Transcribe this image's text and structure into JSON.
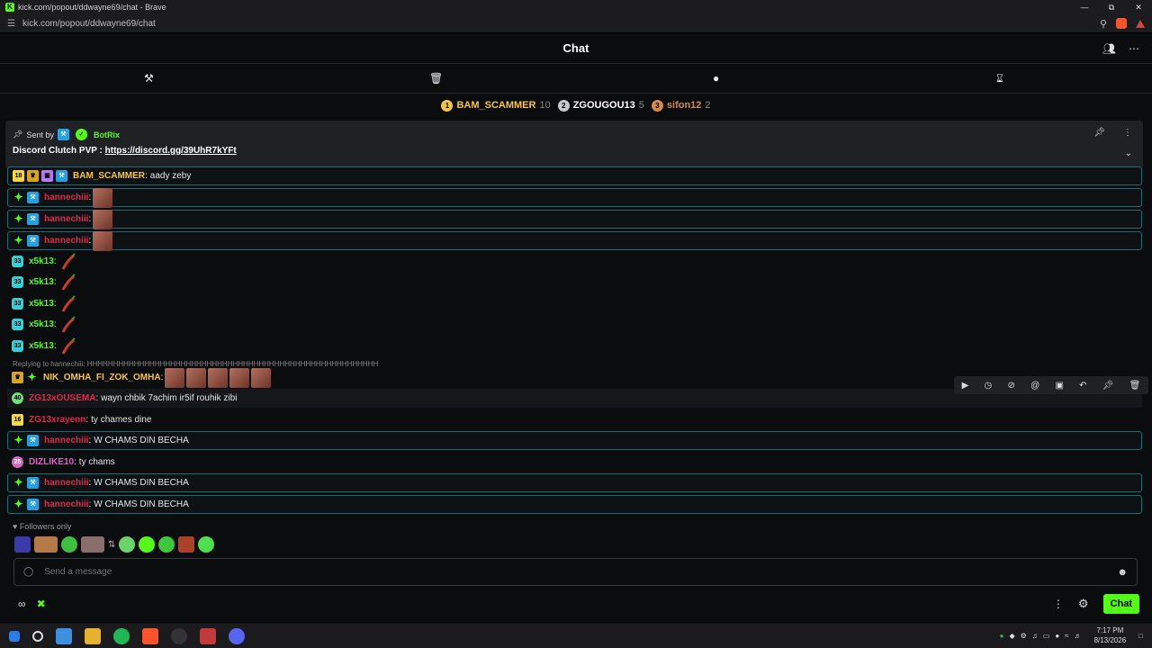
{
  "browser": {
    "window_title": "kick.com/popout/ddwayne69/chat - Brave",
    "url": "kick.com/popout/ddwayne69/chat"
  },
  "chat": {
    "title": "Chat",
    "leaderboard": [
      {
        "rank": "1",
        "name": "BAM_SCAMMER",
        "count": "10",
        "color": "#f5c542"
      },
      {
        "rank": "2",
        "name": "ZGOUGOU13",
        "count": "5",
        "color": "#c9c9c9"
      },
      {
        "rank": "3",
        "name": "sifon12",
        "count": "2",
        "color": "#d28b4f"
      }
    ],
    "pinned": {
      "sent_by": "Sent by",
      "bot_name": "BotRix",
      "message_prefix": "Discord Clutch PVP : ",
      "link": "https://discord.gg/39UhR7kYFt"
    },
    "messages": [
      {
        "user": "BAM_SCAMMER",
        "color": "#f5c542",
        "text": "aady zeby",
        "badge_text": "18"
      },
      {
        "user": "hannechiii",
        "color": "#e0294a",
        "text": ""
      },
      {
        "user": "hannechiii",
        "color": "#e0294a",
        "text": ""
      },
      {
        "user": "hannechiii",
        "color": "#e0294a",
        "text": ""
      },
      {
        "user": "x5k13",
        "color": "#53fc18",
        "text": "",
        "badge_text": "33"
      },
      {
        "user": "x5k13",
        "color": "#53fc18",
        "text": "",
        "badge_text": "33"
      },
      {
        "user": "x5k13",
        "color": "#53fc18",
        "text": "",
        "badge_text": "33"
      },
      {
        "user": "x5k13",
        "color": "#53fc18",
        "text": "",
        "badge_text": "33"
      },
      {
        "user": "x5k13",
        "color": "#53fc18",
        "text": "",
        "badge_text": "33"
      },
      {
        "user": "NIK_OMHA_FI_ZOK_OMHA",
        "color": "#f5c542",
        "text": ""
      },
      {
        "user": "ZG13xOUSEMA",
        "color": "#e0294a",
        "text": "wayn chbik 7achim ir5if rouhik zibi",
        "badge_text": "40"
      },
      {
        "user": "ZG13xrayenn",
        "color": "#e0294a",
        "text": "ty chames dine",
        "badge_text": "16"
      },
      {
        "user": "hannechiii",
        "color": "#e0294a",
        "text": "W CHAMS DIN BECHA"
      },
      {
        "user": "DIZLIKE10",
        "color": "#e062c7",
        "text": "ty chams",
        "badge_text": "25"
      },
      {
        "user": "hannechiii",
        "color": "#e0294a",
        "text": "W CHAMS DIN BECHA"
      },
      {
        "user": "hannechiii",
        "color": "#e0294a",
        "text": "W CHAMS DIN BECHA"
      }
    ],
    "reply_note": "Replying to hannechiii: HHHHHHHHHHHHHHHHHHHHHHHHHHHHHHHHHHHHHHHHHHHHHHHHHHHHHHHH",
    "followers_only": "Followers only",
    "input_placeholder": "Send a message",
    "send_label": "Chat"
  },
  "taskbar": {
    "time": "7:17 PM",
    "date": "8/13/2026"
  },
  "colors": {
    "accent": "#53fc18",
    "mod_blue": "#27a0e0",
    "highlight_border": "#1f6a73"
  }
}
